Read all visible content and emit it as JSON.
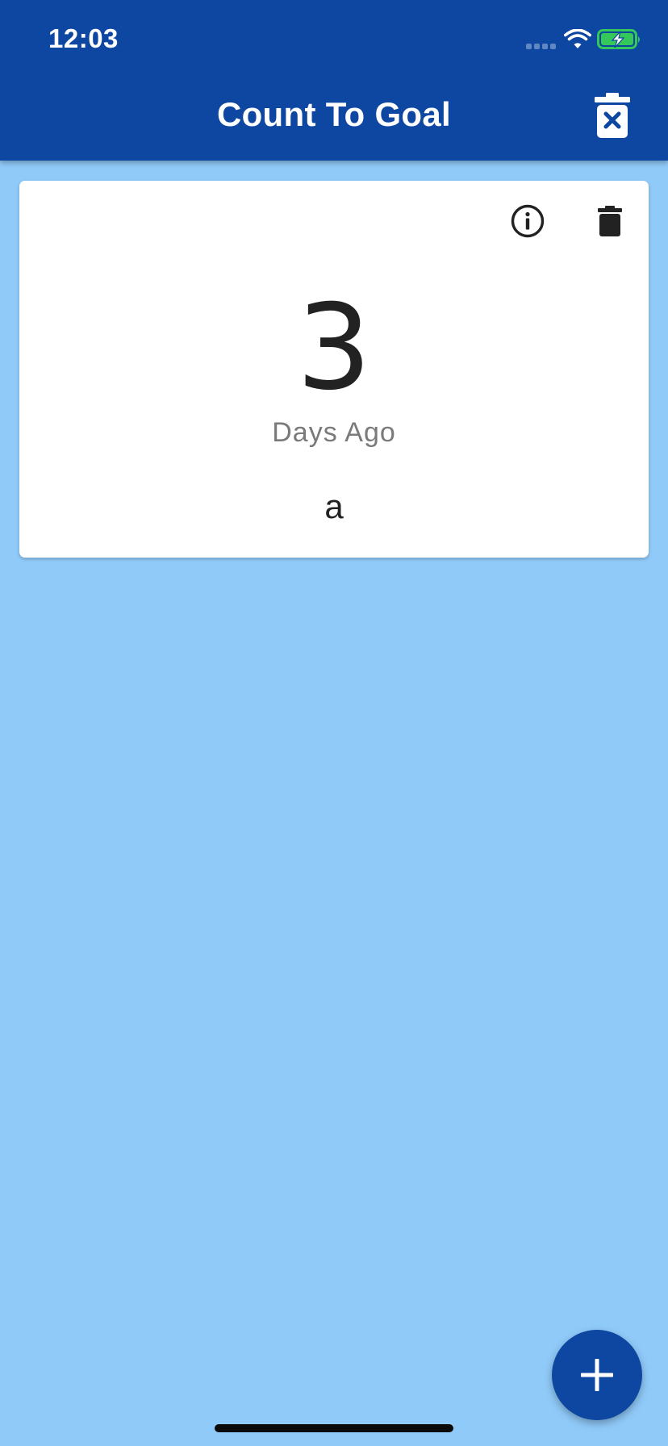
{
  "status_bar": {
    "time": "12:03",
    "icons": [
      "cellular-signal-icon",
      "wifi-icon",
      "battery-charging-icon"
    ]
  },
  "app_bar": {
    "title": "Count To Goal",
    "action_icon": "delete-forever-icon"
  },
  "goals": [
    {
      "count": "3",
      "unit_label": "Days Ago",
      "name": "a",
      "actions": [
        "info-icon",
        "delete-icon"
      ]
    }
  ],
  "fab": {
    "icon": "add-icon"
  },
  "colors": {
    "primary": "#0D47A1",
    "background": "#90CAF9",
    "card": "#FFFFFF",
    "battery_fill": "#34C759"
  }
}
